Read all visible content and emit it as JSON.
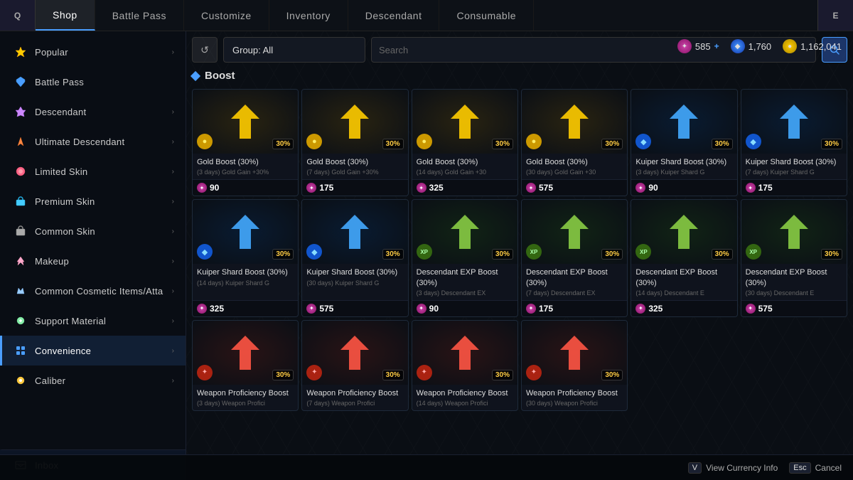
{
  "nav": {
    "left_key": "Q",
    "right_key": "E",
    "items": [
      {
        "id": "shop",
        "label": "Shop",
        "active": true
      },
      {
        "id": "battle-pass",
        "label": "Battle Pass",
        "active": false
      },
      {
        "id": "customize",
        "label": "Customize",
        "active": false
      },
      {
        "id": "inventory",
        "label": "Inventory",
        "active": false
      },
      {
        "id": "descendant",
        "label": "Descendant",
        "active": false
      },
      {
        "id": "consumable",
        "label": "Consumable",
        "active": false
      }
    ]
  },
  "currency": {
    "pink": {
      "amount": "585",
      "plus": true
    },
    "blue": {
      "amount": "1,760"
    },
    "gold": {
      "amount": "1,162,041"
    }
  },
  "filter": {
    "refresh_label": "↺",
    "group_label": "Group: All",
    "search_placeholder": "Search"
  },
  "section": {
    "title": "Boost"
  },
  "sidebar": {
    "items": [
      {
        "id": "popular",
        "label": "Popular",
        "has_arrow": true
      },
      {
        "id": "battle-pass",
        "label": "Battle Pass",
        "has_arrow": false
      },
      {
        "id": "descendant",
        "label": "Descendant",
        "has_arrow": true
      },
      {
        "id": "ultimate-descendant",
        "label": "Ultimate Descendant",
        "has_arrow": true
      },
      {
        "id": "limited-skin",
        "label": "Limited Skin",
        "has_arrow": true
      },
      {
        "id": "premium-skin",
        "label": "Premium Skin",
        "has_arrow": true
      },
      {
        "id": "common-skin",
        "label": "Common Skin",
        "has_arrow": true
      },
      {
        "id": "makeup",
        "label": "Makeup",
        "has_arrow": true
      },
      {
        "id": "common-cosmetic",
        "label": "Common Cosmetic Items/Atta",
        "has_arrow": true
      },
      {
        "id": "support-material",
        "label": "Support Material",
        "has_arrow": true
      },
      {
        "id": "convenience",
        "label": "Convenience",
        "has_arrow": true
      },
      {
        "id": "caliber",
        "label": "Caliber",
        "has_arrow": true
      }
    ],
    "inbox": {
      "label": "Inbox"
    }
  },
  "items": [
    {
      "id": "gold-boost-3",
      "type": "gold",
      "name": "Gold Boost (30%)",
      "desc": "(3 days) Gold Gain +30%",
      "price": "90"
    },
    {
      "id": "gold-boost-7",
      "type": "gold",
      "name": "Gold Boost (30%)",
      "desc": "(7 days) Gold Gain +30%",
      "price": "175"
    },
    {
      "id": "gold-boost-14",
      "type": "gold",
      "name": "Gold Boost (30%)",
      "desc": "(14 days) Gold Gain +30",
      "price": "325"
    },
    {
      "id": "gold-boost-30",
      "type": "gold",
      "name": "Gold Boost (30%)",
      "desc": "(30 days) Gold Gain +30",
      "price": "575"
    },
    {
      "id": "kuiper-boost-3",
      "type": "kuiper",
      "name": "Kuiper Shard Boost (30%)",
      "desc": "(3 days) Kuiper Shard G",
      "price": "90"
    },
    {
      "id": "kuiper-boost-7",
      "type": "kuiper",
      "name": "Kuiper Shard Boost (30%)",
      "desc": "(7 days) Kuiper Shard G",
      "price": "175"
    },
    {
      "id": "kuiper-boost-14",
      "type": "kuiper",
      "name": "Kuiper Shard Boost (30%)",
      "desc": "(14 days) Kuiper Shard G",
      "price": "325"
    },
    {
      "id": "kuiper-boost-30",
      "type": "kuiper",
      "name": "Kuiper Shard Boost (30%)",
      "desc": "(30 days) Kuiper Shard G",
      "price": "575"
    },
    {
      "id": "exp-boost-3",
      "type": "exp",
      "name": "Descendant EXP Boost (30%)",
      "desc": "(3 days) Descendant EX",
      "price": "90"
    },
    {
      "id": "exp-boost-7",
      "type": "exp",
      "name": "Descendant EXP Boost (30%)",
      "desc": "(7 days) Descendant EX",
      "price": "175"
    },
    {
      "id": "exp-boost-14",
      "type": "exp",
      "name": "Descendant EXP Boost (30%)",
      "desc": "(14 days) Descendant E",
      "price": "325"
    },
    {
      "id": "exp-boost-30",
      "type": "exp",
      "name": "Descendant EXP Boost (30%)",
      "desc": "(30 days) Descendant E",
      "price": "575"
    },
    {
      "id": "weapon-boost-3",
      "type": "weapon",
      "name": "Weapon Proficiency Boost",
      "desc": "(3 days) Weapon Profici",
      "price": null
    },
    {
      "id": "weapon-boost-7",
      "type": "weapon",
      "name": "Weapon Proficiency Boost",
      "desc": "(7 days) Weapon Profici",
      "price": null
    },
    {
      "id": "weapon-boost-14",
      "type": "weapon",
      "name": "Weapon Proficiency Boost",
      "desc": "(14 days) Weapon Profici",
      "price": null
    },
    {
      "id": "weapon-boost-30",
      "type": "weapon",
      "name": "Weapon Proficiency Boost",
      "desc": "(30 days) Weapon Profici",
      "price": null
    }
  ],
  "bottom": {
    "view_key": "V",
    "view_label": "View Currency Info",
    "cancel_key": "Esc",
    "cancel_label": "Cancel"
  }
}
